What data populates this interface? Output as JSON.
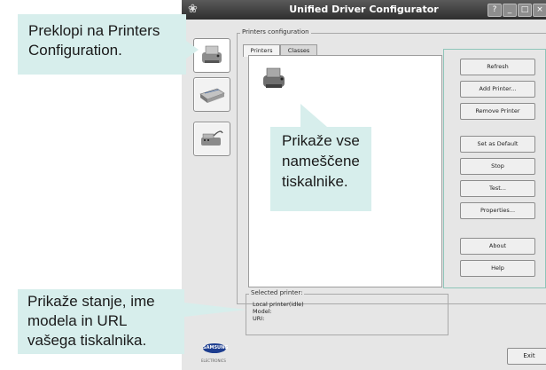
{
  "window": {
    "title": "Unified Driver Configurator",
    "controls": {
      "help": "?",
      "minimize": "_",
      "maximize": "□",
      "close": "×"
    }
  },
  "sidebar": {
    "items": [
      {
        "name": "printers",
        "icon": "printer-icon",
        "selected": true
      },
      {
        "name": "scanners",
        "icon": "scanner-icon",
        "selected": false
      },
      {
        "name": "ports",
        "icon": "port-icon",
        "selected": false
      }
    ]
  },
  "config": {
    "legend": "Printers configuration",
    "tabs": [
      {
        "label": "Printers"
      },
      {
        "label": "Classes"
      }
    ]
  },
  "buttons": {
    "refresh": "Refresh",
    "add_printer": "Add Printer...",
    "remove_printer": "Remove Printer",
    "set_default": "Set as Default",
    "stop": "Stop",
    "test": "Test...",
    "properties": "Properties...",
    "about": "About",
    "help": "Help"
  },
  "selected": {
    "legend": "Selected printer:",
    "line1": "Local printer(idle)",
    "line2": "Model:",
    "line3": "URI:"
  },
  "footer": {
    "exit": "Exit",
    "brand": "SAMSUNG",
    "brand_sub": "ELECTRONICS"
  },
  "callouts": {
    "printers_config": {
      "line1": "Preklopi na Printers",
      "line2": "Configuration."
    },
    "installed": {
      "line1": "Prikaže vse",
      "line2": "nameščene",
      "line3": "tiskalnike."
    },
    "status": {
      "line1": "Prikaže stanje, ime",
      "line2": "modela in URL",
      "line3": "vašega tiskalnika."
    }
  },
  "colors": {
    "callout_bg": "#d7eeec",
    "highlight_border": "#8ec5b9",
    "titlebar": "#3a3a3a"
  }
}
